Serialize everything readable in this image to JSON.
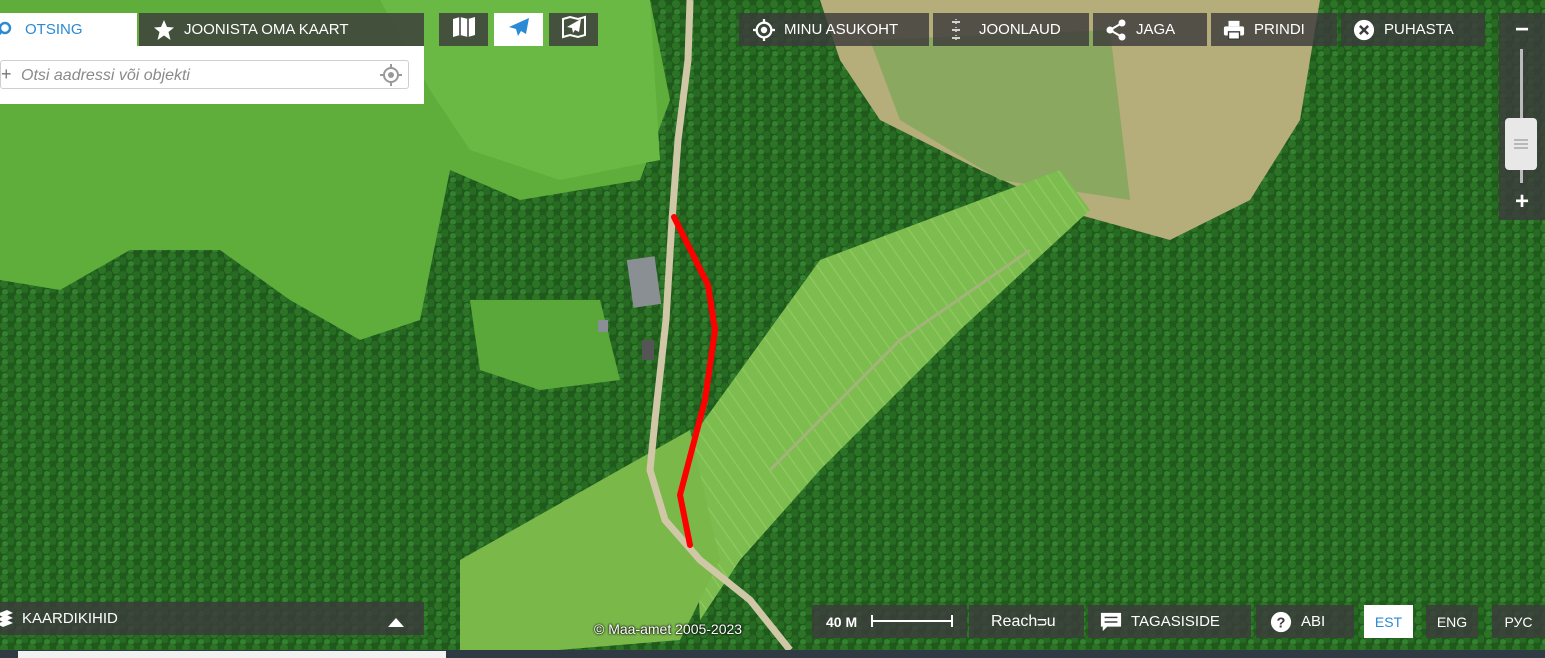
{
  "top_left": {
    "search_tab": "OTSING",
    "draw_tab": "JOONISTA OMA KAART",
    "search_placeholder": "Otsi aadressi või objekti"
  },
  "top_right": {
    "my_location": "MINU ASUKOHT",
    "rulers": "JOONLAUD",
    "share": "JAGA",
    "print": "PRINDI",
    "clear": "PUHASTA"
  },
  "bottom": {
    "layers": "KAARDIKIHID",
    "copyright": "© Maa-amet 2005-2023",
    "scale": "40 M",
    "mode": "Reach7u",
    "mode_display": "Reachᴝu",
    "feedback": "TAGASISIDE",
    "help": "ABI",
    "languages": [
      "EST",
      "ENG",
      "РУС"
    ]
  },
  "colors": {
    "accent": "#2a8ad4",
    "route": "#ff0000",
    "toolbar_bg": "#3c3c3c"
  },
  "icons": [
    "search-icon",
    "star-icon",
    "map-icon",
    "plane-icon",
    "hybrid-icon",
    "locate-icon",
    "ruler-icon",
    "share-icon",
    "print-icon",
    "close-icon",
    "layers-icon",
    "chevron-up-icon",
    "feedback-icon",
    "help-icon"
  ]
}
